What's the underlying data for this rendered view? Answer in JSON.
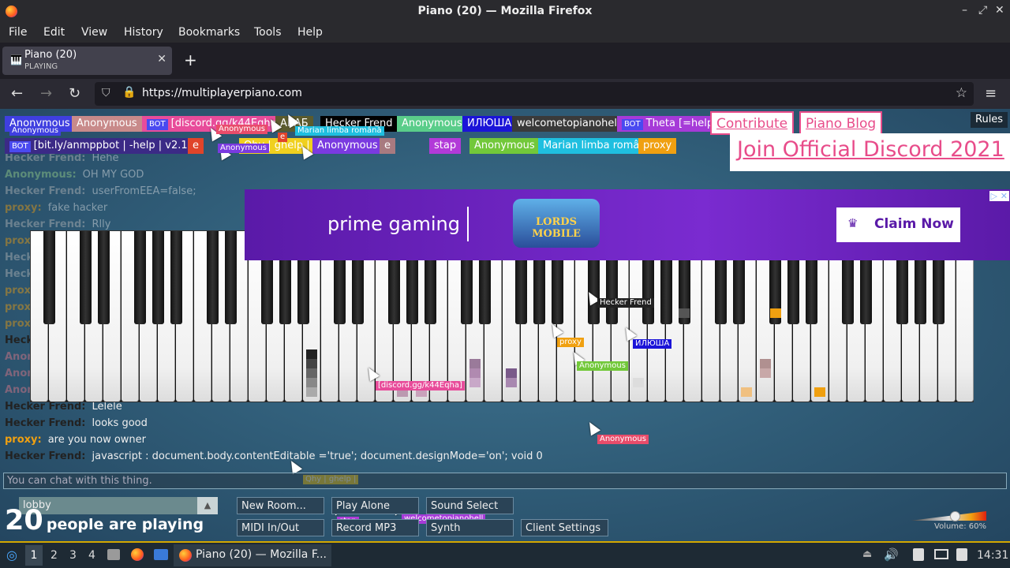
{
  "window": {
    "title": "Piano (20) — Mozilla Firefox"
  },
  "menu": [
    "File",
    "Edit",
    "View",
    "History",
    "Bookmarks",
    "Tools",
    "Help"
  ],
  "tab": {
    "title": "Piano (20)",
    "subtitle": "PLAYING"
  },
  "url": "https://multiplayerpiano.com",
  "links": {
    "contribute": "Contribute",
    "blog": "Piano Blog",
    "discord": "Join Official Discord 2021",
    "rules": "Rules"
  },
  "users_row1": [
    {
      "name": "Anonymous",
      "color": "#3f3fe0"
    },
    {
      "name": "Anonymous",
      "color": "#c88a8a"
    },
    {
      "name": "[discord.gg/k44Eqha]",
      "color": "#e84c9a",
      "bot": true
    },
    {
      "name": "АБАБ",
      "color": "#5b5b2e"
    },
    {
      "name": "Hecker Frend",
      "color": "#000000"
    },
    {
      "name": "Anonymous",
      "color": "#5acd8a"
    },
    {
      "name": "ИЛЮША",
      "color": "#1b14d8"
    },
    {
      "name": "welcometopianohell",
      "color": "#3a3a3a"
    },
    {
      "name": "Theta [=help]",
      "color": "#a63ad8",
      "bot": true
    }
  ],
  "users_row2": [
    {
      "name": "[bit.ly/anmppbot | -help | v2.1]",
      "color": "#3b2a86",
      "bot": true
    },
    {
      "name": "e",
      "color": "#e0442a"
    },
    {
      "name": "Qhy | ghelp |",
      "color": "#f0d01f"
    },
    {
      "name": "Anonymous",
      "color": "#7a3ae0"
    },
    {
      "name": "e",
      "color": "#a87a80"
    },
    {
      "name": "stap",
      "color": "#b23ad8"
    },
    {
      "name": "Anonymous",
      "color": "#72c83a"
    },
    {
      "name": "Marian limba română",
      "color": "#1fbfe0"
    },
    {
      "name": "proxy",
      "color": "#f0a010"
    }
  ],
  "chat": [
    {
      "name": "Hecker Frend:",
      "msg": "Hehe",
      "color": "#b9b9b9",
      "fade": true
    },
    {
      "name": "Anonymous:",
      "msg": "OH MY GOD",
      "color": "#9ad48a",
      "fade": true
    },
    {
      "name": "Hecker Frend:",
      "msg": "userFromEEA=false;",
      "color": "#b9b9b9",
      "fade": true
    },
    {
      "name": "proxy:",
      "msg": "fake hacker",
      "color": "#f0a010",
      "fade": true
    },
    {
      "name": "Hecker Frend:",
      "msg": "Rlly",
      "color": "#b9b9b9",
      "fade": true
    },
    {
      "name": "proxy:",
      "msg": "",
      "color": "#f0a010",
      "fade": true
    },
    {
      "name": "Heck",
      "msg": "",
      "color": "#b9b9b9",
      "fade": true
    },
    {
      "name": "Heck",
      "msg": "",
      "color": "#b9b9b9",
      "fade": true
    },
    {
      "name": "proxy",
      "msg": "",
      "color": "#f0a010",
      "fade": true
    },
    {
      "name": "proxy",
      "msg": "",
      "color": "#f0a010",
      "fade": true
    },
    {
      "name": "prox",
      "msg": "",
      "color": "#f0a010",
      "fade": true
    },
    {
      "name": "Heck",
      "msg": "",
      "color": "#222222",
      "fade": false
    },
    {
      "name": "Anon",
      "msg": "",
      "color": "#e87a8a",
      "fade": true
    },
    {
      "name": "Anon",
      "msg": "",
      "color": "#e87a8a",
      "fade": true
    },
    {
      "name": "Anon",
      "msg": "",
      "color": "#e87a8a",
      "fade": true
    },
    {
      "name": "Hecker Frend:",
      "msg": "Lelele",
      "color": "#222222",
      "fade": false
    },
    {
      "name": "Hecker Frend:",
      "msg": "looks good",
      "color": "#222222",
      "fade": false
    },
    {
      "name": "proxy:",
      "msg": "are you now owner",
      "color": "#f0a010",
      "fade": false
    },
    {
      "name": "Hecker Frend:",
      "msg": "javascript : document.body.contentEditable ='true'; document.designMode='on'; void 0",
      "color": "#222222",
      "fade": false
    }
  ],
  "chat_input_placeholder": "You can chat with this thing.",
  "ad": {
    "brand": "prime gaming",
    "game": "LORDS MOBILE",
    "cta": "Claim Now"
  },
  "cursor_tags": [
    {
      "name": "Hecker Frend",
      "color": "#222222"
    },
    {
      "name": "proxy",
      "color": "#f0a010"
    },
    {
      "name": "ИЛЮША",
      "color": "#1b14d8"
    },
    {
      "name": "Anonymous",
      "color": "#72c83a"
    },
    {
      "name": "[discord.gg/k44Eqha]",
      "color": "#e84c9a"
    },
    {
      "name": "Anonymous",
      "color": "#e84c6a"
    },
    {
      "name": "Qhy | ghelp |",
      "color": "#f0d01f"
    },
    {
      "name": "Anonymous",
      "color": "#e84c6a"
    },
    {
      "name": "stap",
      "color": "#b23ad8"
    },
    {
      "name": "welcometopianohell",
      "color": "#a63ad8"
    },
    {
      "name": "Anonymous",
      "color": "#3f3fe0"
    },
    {
      "name": "Marian limba română",
      "color": "#1fbfe0"
    },
    {
      "name": "Anonymous",
      "color": "#7a3ae0"
    },
    {
      "name": "e",
      "color": "#e0442a"
    }
  ],
  "room": {
    "name": "lobby",
    "count": "20",
    "label": "people are playing"
  },
  "buttons": {
    "new_room": "New Room...",
    "play_alone": "Play Alone",
    "sound_select": "Sound Select",
    "midi": "MIDI In/Out",
    "record": "Record MP3",
    "synth": "Synth",
    "client_settings": "Client Settings"
  },
  "volume": {
    "label": "Volume: 60%",
    "level": 0.6
  },
  "taskbar": {
    "workspaces": [
      "1",
      "2",
      "3",
      "4"
    ],
    "window": "Piano (20) — Mozilla F...",
    "clock": "14:31"
  }
}
